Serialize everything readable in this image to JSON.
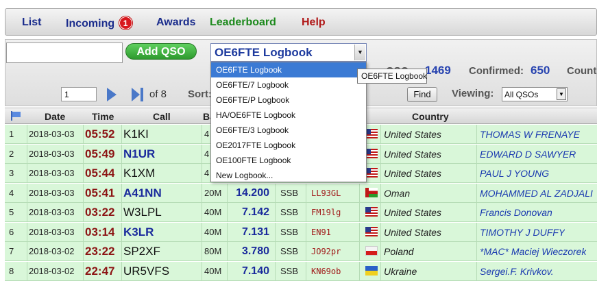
{
  "nav": {
    "list": "List",
    "incoming": "Incoming",
    "incoming_badge": "1",
    "awards": "Awards",
    "leaderboard": "Leaderboard",
    "help": "Help"
  },
  "toolbar": {
    "call_value": "",
    "add_qso": "Add QSO",
    "logbook_selected": "OE6FTE Logbook",
    "qsos_label": "QSOs:",
    "qsos_count": "1469",
    "confirmed_label": "Confirmed:",
    "confirmed_count": "650",
    "count_label": "Count",
    "page_value": "1",
    "of_pages": "of 8",
    "sort_label": "Sort:",
    "find": "Find",
    "viewing_label": "Viewing:",
    "viewing_value": "All QSOs"
  },
  "dropdown": {
    "items": [
      "OE6FTE Logbook",
      "OE6FTE/7 Logbook",
      "OE6FTE/P Logbook",
      "HA/OE6FTE Logbook",
      "OE6FTE/3 Logbook",
      "OE2017FTE Logbook",
      "OE100FTE Logbook",
      "New Logbook..."
    ],
    "tooltip": "OE6FTE Logbook"
  },
  "table": {
    "headers": {
      "date": "Date",
      "time": "Time",
      "call": "Call",
      "band": "Ba",
      "country": "Country"
    },
    "rows": [
      {
        "num": "1",
        "date": "2018-03-03",
        "time": "05:52",
        "call": "K1KI",
        "call_bold": false,
        "band": "4",
        "freq": "",
        "mode": "",
        "grid": "",
        "flag": "us",
        "country": "United States",
        "name": "THOMAS W FRENAYE"
      },
      {
        "num": "2",
        "date": "2018-03-03",
        "time": "05:49",
        "call": "N1UR",
        "call_bold": true,
        "band": "4",
        "freq": "",
        "mode": "",
        "grid": "",
        "flag": "us",
        "country": "United States",
        "name": "EDWARD D SAWYER"
      },
      {
        "num": "3",
        "date": "2018-03-03",
        "time": "05:44",
        "call": "K1XM",
        "call_bold": false,
        "band": "4",
        "freq": "",
        "mode": "",
        "grid": "",
        "flag": "us",
        "country": "United States",
        "name": "PAUL J YOUNG"
      },
      {
        "num": "4",
        "date": "2018-03-03",
        "time": "05:41",
        "call": "A41NN",
        "call_bold": true,
        "band": "20M",
        "freq": "14.200",
        "mode": "SSB",
        "grid": "LL93GL",
        "flag": "om",
        "country": "Oman",
        "name": "MOHAMMED AL ZADJALI"
      },
      {
        "num": "5",
        "date": "2018-03-03",
        "time": "03:22",
        "call": "W3LPL",
        "call_bold": false,
        "band": "40M",
        "freq": "7.142",
        "mode": "SSB",
        "grid": "FM19lg",
        "flag": "us",
        "country": "United States",
        "name": "Francis Donovan"
      },
      {
        "num": "6",
        "date": "2018-03-03",
        "time": "03:14",
        "call": "K3LR",
        "call_bold": true,
        "band": "40M",
        "freq": "7.131",
        "mode": "SSB",
        "grid": "EN91",
        "flag": "us",
        "country": "United States",
        "name": "TIMOTHY J DUFFY"
      },
      {
        "num": "7",
        "date": "2018-03-02",
        "time": "23:22",
        "call": "SP2XF",
        "call_bold": false,
        "band": "80M",
        "freq": "3.780",
        "mode": "SSB",
        "grid": "JO92pr",
        "flag": "pl",
        "country": "Poland",
        "name": "*MAC* Maciej Wieczorek"
      },
      {
        "num": "8",
        "date": "2018-03-02",
        "time": "22:47",
        "call": "UR5VFS",
        "call_bold": false,
        "band": "40M",
        "freq": "7.140",
        "mode": "SSB",
        "grid": "KN69ob",
        "flag": "ua",
        "country": "Ukraine",
        "name": "Sergei.F. Krivkov."
      }
    ]
  }
}
